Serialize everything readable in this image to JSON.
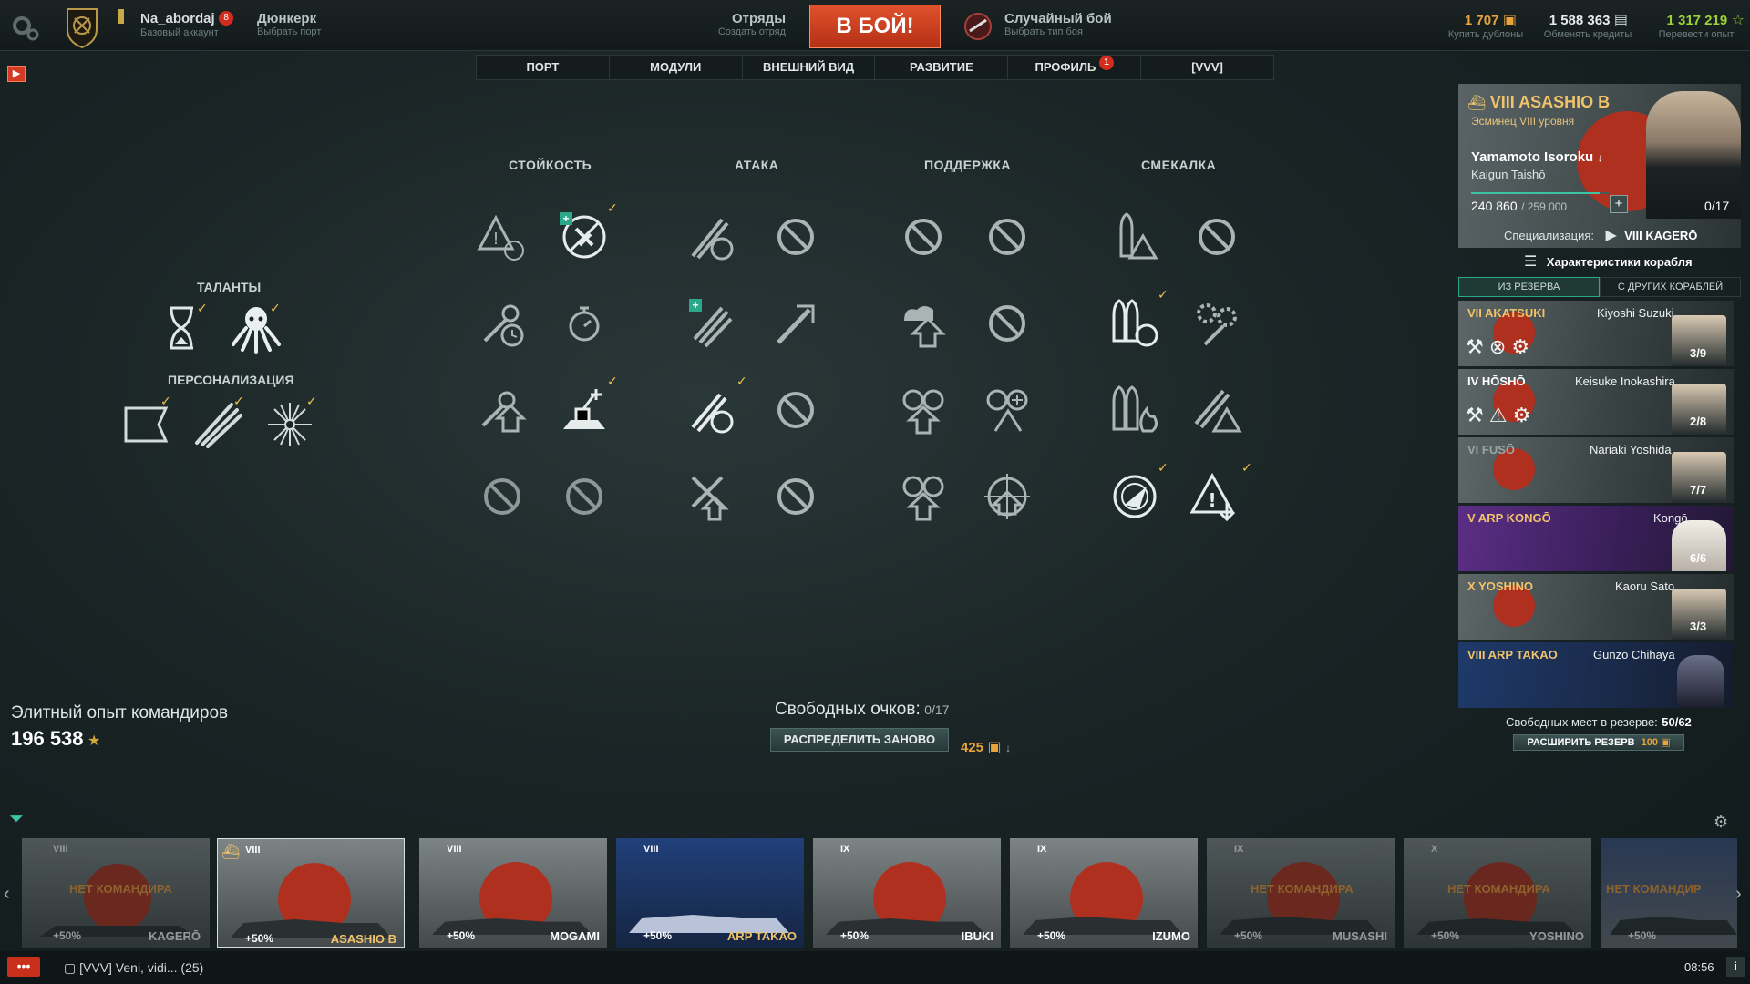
{
  "topbar": {
    "username": "Na_abordaj",
    "username_badge": "8",
    "account_type": "Базовый аккаунт",
    "port_name": "Дюнкерк",
    "port_sub": "Выбрать порт",
    "squad_label": "Отряды",
    "squad_sub": "Создать отряд",
    "battle_button": "В БОЙ!",
    "battle_mode": "Случайный бой",
    "battle_mode_sub": "Выбрать тип боя",
    "doubloons": "1 707",
    "doubloons_sub": "Купить дублоны",
    "credits": "1 588 363",
    "credits_sub": "Обменять кредиты",
    "free_xp": "1 317 219",
    "free_xp_sub": "Перевести опыт"
  },
  "tabs": [
    {
      "label": "ПОРТ"
    },
    {
      "label": "МОДУЛИ"
    },
    {
      "label": "ВНЕШНИЙ ВИД"
    },
    {
      "label": "РАЗВИТИЕ"
    },
    {
      "label": "ПРОФИЛЬ",
      "badge": "1"
    },
    {
      "label": "[VVV]"
    }
  ],
  "sections": {
    "talents": "ТАЛАНТЫ",
    "personalization": "ПЕРСОНАЛИЗАЦИЯ"
  },
  "skill_columns": [
    "СТОЙКОСТЬ",
    "АТАКА",
    "ПОДДЕРЖКА",
    "СМЕКАЛКА"
  ],
  "elite_xp": {
    "label": "Элитный опыт командиров",
    "value": "196 538"
  },
  "points": {
    "label": "Свободных очков:",
    "value": "0/17",
    "reset_button": "РАСПРЕДЕЛИТЬ ЗАНОВО",
    "reset_cost": "425"
  },
  "commander": {
    "ship": "VIII ASASHIO B",
    "ship_type": "Эсминец VIII уровня",
    "name": "Yamamoto Isoroku",
    "rank": "Kaigun Taishō",
    "xp": "240 860",
    "xp_max": "/ 259 000",
    "points": "0/17",
    "spec_label": "Специализация:",
    "spec_ship": "VIII KAGERŌ",
    "ship_stats": "Характеристики корабля"
  },
  "reserve_tabs": [
    "ИЗ РЕЗЕРВА",
    "С ДРУГИХ КОРАБЛЕЙ"
  ],
  "reserve": [
    {
      "ship": "VII AKATSUKI",
      "name": "Kiyoshi Suzuki",
      "count": "3/9"
    },
    {
      "ship": "IV HŌSHŌ",
      "name": "Keisuke Inokashira",
      "count": "2/8"
    },
    {
      "ship": "VI FUSŌ",
      "name": "Nariaki Yoshida",
      "count": "7/7"
    },
    {
      "ship": "V ARP KONGŌ",
      "name": "Kongō",
      "count": "6/6"
    },
    {
      "ship": "X YOSHINO",
      "name": "Kaoru Sato",
      "count": "3/3"
    },
    {
      "ship": "VIII ARP TAKAO",
      "name": "Gunzo Chihaya",
      "count": ""
    }
  ],
  "reserve_footer": {
    "label": "Свободных мест в резерве:",
    "value": "50/62",
    "expand_button": "РАСШИРИТЬ РЕЗЕРВ",
    "expand_cost": "100"
  },
  "carousel": [
    {
      "tier": "VIII",
      "name": "KAGERŌ",
      "bonus": "+50%",
      "nocmd": "НЕТ КОМАНДИРА"
    },
    {
      "tier": "VIII",
      "name": "ASASHIO B",
      "bonus": "+50%",
      "nocmd": ""
    },
    {
      "tier": "VIII",
      "name": "MOGAMI",
      "bonus": "+50%",
      "nocmd": ""
    },
    {
      "tier": "VIII",
      "name": "ARP TAKAO",
      "bonus": "+50%",
      "nocmd": ""
    },
    {
      "tier": "IX",
      "name": "IBUKI",
      "bonus": "+50%",
      "nocmd": ""
    },
    {
      "tier": "IX",
      "name": "IZUMO",
      "bonus": "+50%",
      "nocmd": ""
    },
    {
      "tier": "IX",
      "name": "MUSASHI",
      "bonus": "+50%",
      "nocmd": "НЕТ КОМАНДИРА"
    },
    {
      "tier": "X",
      "name": "YOSHINO",
      "bonus": "+50%",
      "nocmd": "НЕТ КОМАНДИРА"
    },
    {
      "tier": "",
      "name": "",
      "bonus": "+50%",
      "nocmd": "НЕТ КОМАНДИР"
    }
  ],
  "bottom": {
    "chat_channel": "[VVV] Veni, vidi...",
    "chat_count": "(25)",
    "time": "08:56"
  }
}
